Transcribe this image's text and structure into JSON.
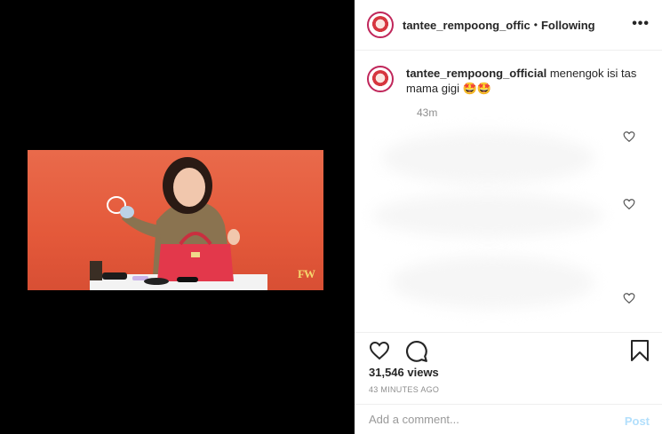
{
  "media": {
    "watermark": "FW"
  },
  "header": {
    "username": "tantee_rempoong_offic",
    "separator": "•",
    "follow_status": "Following",
    "more_label": "•••"
  },
  "caption": {
    "username": "tantee_rempoong_official",
    "text": " menengok isi tas mama gigi 🤩🤩",
    "time": "43m"
  },
  "actions": {
    "like_icon": "heart-icon",
    "comment_icon": "comment-icon",
    "save_icon": "bookmark-icon",
    "views": "31,546 views",
    "posted_ago": "43 MINUTES AGO"
  },
  "add_comment": {
    "placeholder": "Add a comment...",
    "post_label": "Post"
  },
  "colors": {
    "video_background": "#e4593a",
    "post_button": "#b2dffc",
    "avatar_ring": "#c0265a"
  }
}
